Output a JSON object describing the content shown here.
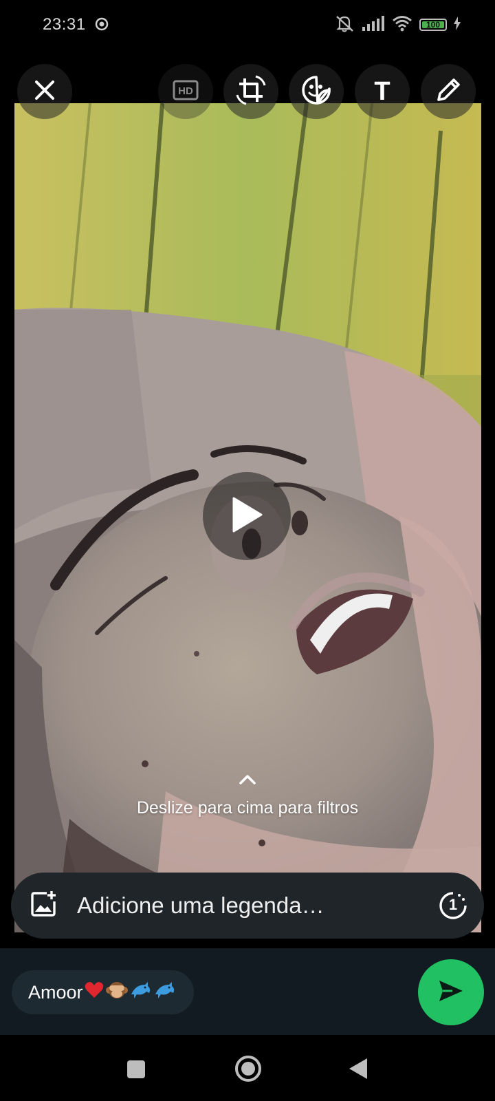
{
  "status_bar": {
    "time": "23:31",
    "battery_level": "100",
    "icons": [
      "whatsapp-status-icon",
      "mute-icon",
      "signal-icon",
      "wifi-icon",
      "battery-icon",
      "charging-icon"
    ]
  },
  "toolbar": {
    "close_icon": "close-icon",
    "hd_label": "HD",
    "crop_icon": "crop-rotate-icon",
    "sticker_icon": "sticker-icon",
    "text_label": "T",
    "draw_icon": "pencil-icon"
  },
  "media": {
    "type": "video",
    "play_icon": "play-icon"
  },
  "filters_hint": {
    "text": "Deslize para cima para filtros",
    "icon": "chevron-up-icon"
  },
  "caption": {
    "placeholder": "Adicione uma legenda…",
    "add_media_icon": "add-photo-icon",
    "view_once_icon": "view-once-icon",
    "view_once_label": "1"
  },
  "recipient": {
    "name": "Amoor",
    "emojis": [
      "heart-emoji",
      "see-no-evil-monkey-emoji",
      "dolphin-emoji",
      "dolphin-emoji"
    ]
  },
  "send_button": {
    "icon": "send-icon"
  },
  "nav_bar": {
    "icons": [
      "recents-icon",
      "home-icon",
      "back-icon"
    ]
  },
  "colors": {
    "accent_green": "#21c063",
    "caption_bg": "#1f2528",
    "panel_bg": "#121b21",
    "chip_bg": "#1e2a31"
  }
}
